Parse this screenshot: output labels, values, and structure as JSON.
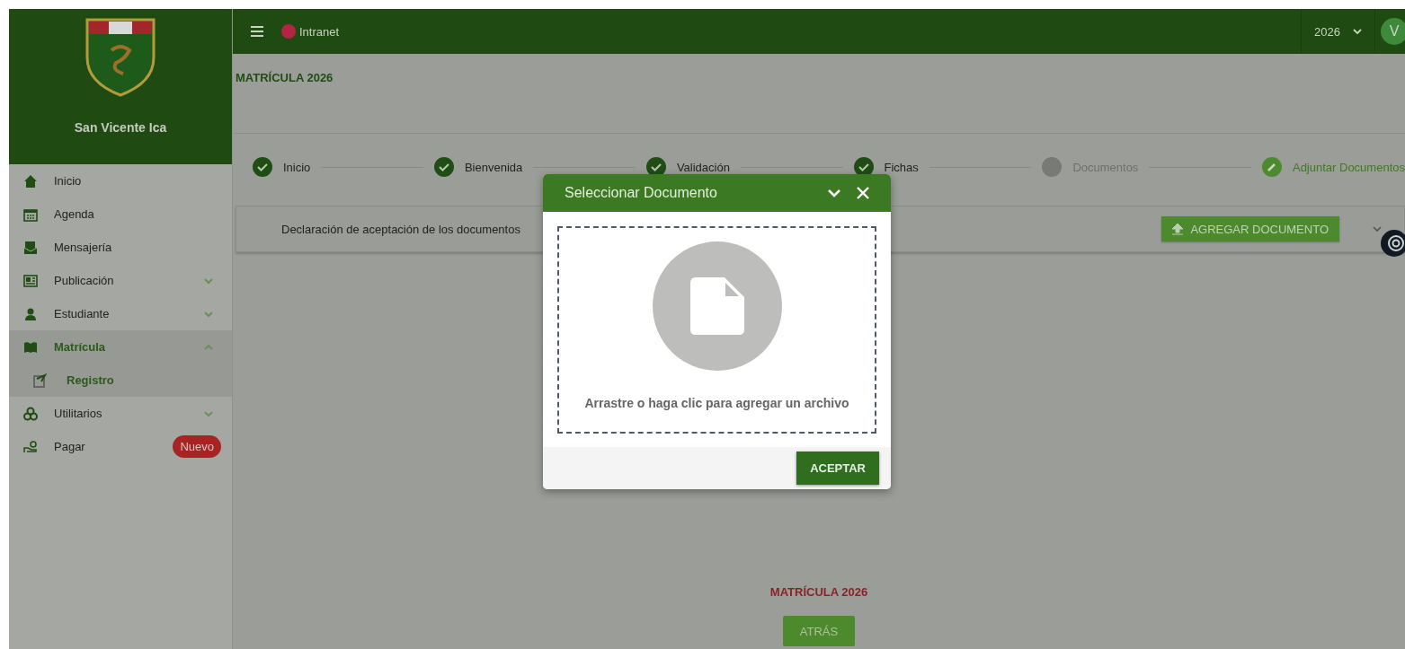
{
  "sidebar": {
    "school_name": "San Vicente Ica",
    "items": [
      {
        "label": "Inicio",
        "kind": "link",
        "selected": false
      },
      {
        "label": "Agenda",
        "kind": "link",
        "selected": false
      },
      {
        "label": "Mensajería",
        "kind": "link",
        "selected": false
      },
      {
        "label": "Publicación",
        "kind": "group",
        "expanded": false,
        "selected": false
      },
      {
        "label": "Estudiante",
        "kind": "group",
        "expanded": false,
        "selected": false
      },
      {
        "label": "Matrícula",
        "kind": "group",
        "expanded": true,
        "selected": true,
        "children": [
          {
            "label": "Registro",
            "selected": true
          }
        ]
      },
      {
        "label": "Utilitarios",
        "kind": "group",
        "expanded": false,
        "selected": false
      },
      {
        "label": "Pagar",
        "kind": "link",
        "selected": false,
        "badge": "Nuevo"
      }
    ]
  },
  "header": {
    "brand": "Intranet",
    "year": "2026",
    "avatar": "V"
  },
  "page_title": "MATRÍCULA 2026",
  "steps": [
    {
      "label": "Inicio",
      "completed": true,
      "active": false
    },
    {
      "label": "Bienvenida",
      "completed": true,
      "active": false
    },
    {
      "label": "Validación",
      "completed": true,
      "active": false
    },
    {
      "label": "Fichas",
      "completed": true,
      "active": false
    },
    {
      "label": "Documentos",
      "completed": false,
      "active": false
    },
    {
      "label": "Adjuntar Documentos",
      "completed": false,
      "active": true
    }
  ],
  "document_row": {
    "text": "Declaración de aceptación de los documentos",
    "button": "AGREGAR DOCUMENTO"
  },
  "footer": {
    "title": "MATRÍCULA 2026",
    "back_button": "ATRÁS"
  },
  "modal": {
    "title": "Seleccionar Documento",
    "drop_text": "Arrastre o haga clic para agregar un archivo",
    "accept_button": "ACEPTAR"
  }
}
